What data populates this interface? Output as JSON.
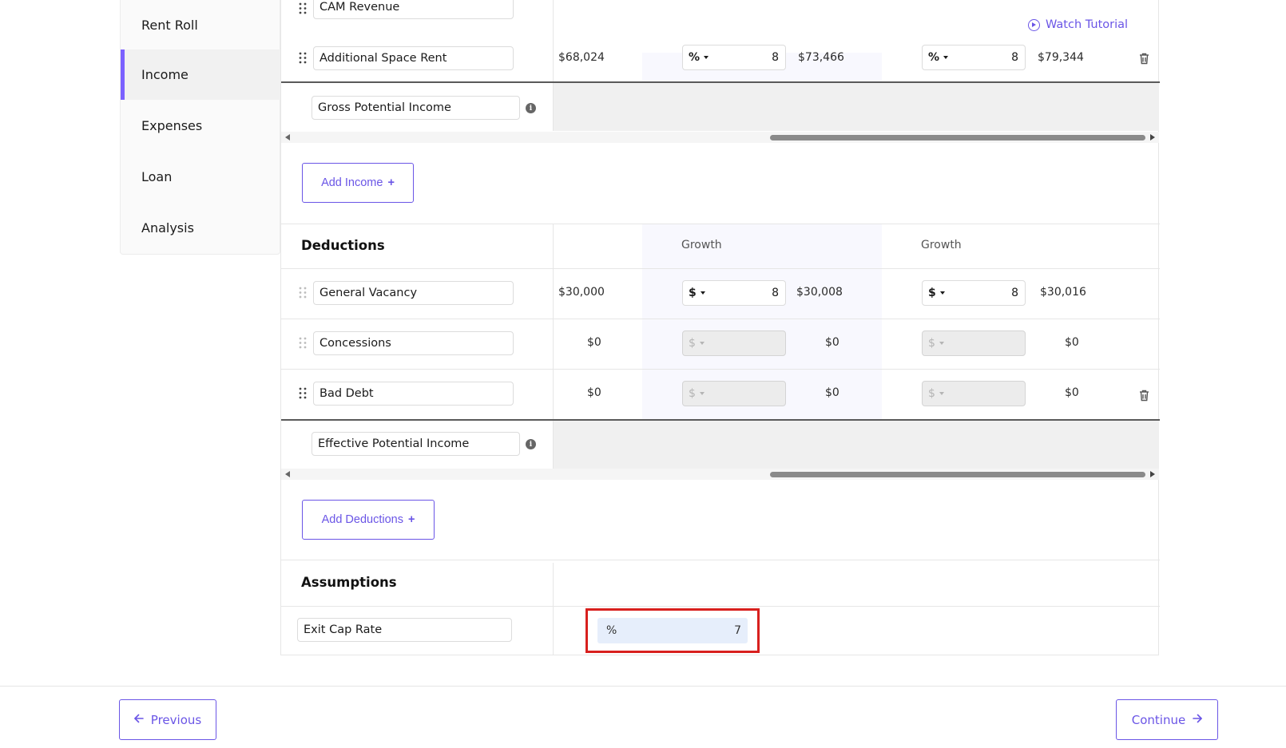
{
  "sidebar": {
    "items": [
      {
        "label": "Rent Roll",
        "active": false
      },
      {
        "label": "Income",
        "active": true
      },
      {
        "label": "Expenses",
        "active": false
      },
      {
        "label": "Loan",
        "active": false
      },
      {
        "label": "Analysis",
        "active": false
      }
    ]
  },
  "header": {
    "watch_tutorial": "Watch Tutorial",
    "play_icon": "play-circle-icon"
  },
  "income": {
    "rows": [
      {
        "name": "CAM Revenue"
      },
      {
        "name": "Additional Space Rent",
        "base": "$68,024",
        "g1_unit": "%",
        "g1_value": "8",
        "y1": "$73,466",
        "g2_unit": "%",
        "g2_value": "8",
        "y2": "$79,344"
      }
    ],
    "total_label": "Gross Potential Income",
    "add_button": "Add Income",
    "add_icon": "+"
  },
  "deductions": {
    "title": "Deductions",
    "growth_label_1": "Growth",
    "growth_label_2": "Growth",
    "rows": [
      {
        "name": "General Vacancy",
        "base": "$30,000",
        "g1_unit": "$",
        "g1_value": "8",
        "y1": "$30,008",
        "g2_unit": "$",
        "g2_value": "8",
        "y2": "$30,016"
      },
      {
        "name": "Concessions",
        "base": "$0",
        "g1_unit": "$",
        "g1_value": "",
        "y1": "$0",
        "g2_unit": "$",
        "g2_value": "",
        "y2": "$0"
      },
      {
        "name": "Bad Debt",
        "base": "$0",
        "g1_unit": "$",
        "g1_value": "",
        "y1": "$0",
        "g2_unit": "$",
        "g2_value": "",
        "y2": "$0"
      }
    ],
    "total_label": "Effective Potential Income",
    "add_button": "Add Deductions",
    "add_icon": "+"
  },
  "assumptions": {
    "title": "Assumptions",
    "exit_cap_label": "Exit Cap Rate",
    "exit_cap_unit": "%",
    "exit_cap_value": "7"
  },
  "footer": {
    "previous": "Previous",
    "continue": "Continue",
    "previous_icon": "arrow-left-icon",
    "continue_icon": "arrow-right-icon"
  },
  "colors": {
    "accent": "#6a55e6",
    "highlight_border": "#d8201e",
    "active_bar": "#7b61ff"
  }
}
